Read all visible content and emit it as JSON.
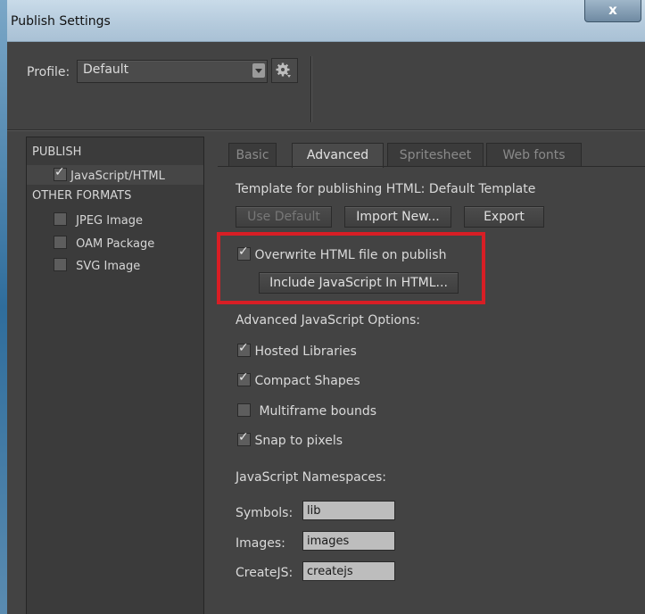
{
  "window": {
    "title": "Publish Settings",
    "close_label": "x"
  },
  "profile": {
    "label": "Profile:",
    "value": "Default"
  },
  "left_panel": {
    "publish_header": "PUBLISH",
    "publish_items": [
      {
        "label": "JavaScript/HTML",
        "checked": true
      }
    ],
    "other_header": "OTHER FORMATS",
    "other_items": [
      {
        "label": "JPEG Image",
        "checked": false
      },
      {
        "label": "OAM Package",
        "checked": false
      },
      {
        "label": "SVG Image",
        "checked": false
      }
    ]
  },
  "tabs": [
    {
      "label": "Basic",
      "active": false
    },
    {
      "label": "Advanced",
      "active": true
    },
    {
      "label": "Spritesheet",
      "active": false
    },
    {
      "label": "Web fonts",
      "active": false
    }
  ],
  "advanced": {
    "template_text": "Template for publishing HTML: Default Template",
    "use_default_label": "Use Default",
    "import_new_label": "Import New...",
    "export_label": "Export",
    "overwrite_label": "Overwrite HTML file on publish",
    "overwrite_checked": true,
    "include_js_label": "Include JavaScript In HTML...",
    "js_options_header": "Advanced JavaScript Options:",
    "js_options": [
      {
        "label": "Hosted Libraries",
        "checked": true
      },
      {
        "label": "Compact Shapes",
        "checked": true
      },
      {
        "label": "Multiframe bounds",
        "checked": false
      },
      {
        "label": "Snap to pixels",
        "checked": true
      }
    ],
    "namespaces_header": "JavaScript Namespaces:",
    "namespaces": [
      {
        "label": "Symbols:",
        "value": "lib"
      },
      {
        "label": "Images:",
        "value": "images"
      },
      {
        "label": "CreateJS:",
        "value": "createjs"
      }
    ]
  },
  "colors": {
    "highlight": "#d81e25",
    "panel_bg": "#434343"
  }
}
